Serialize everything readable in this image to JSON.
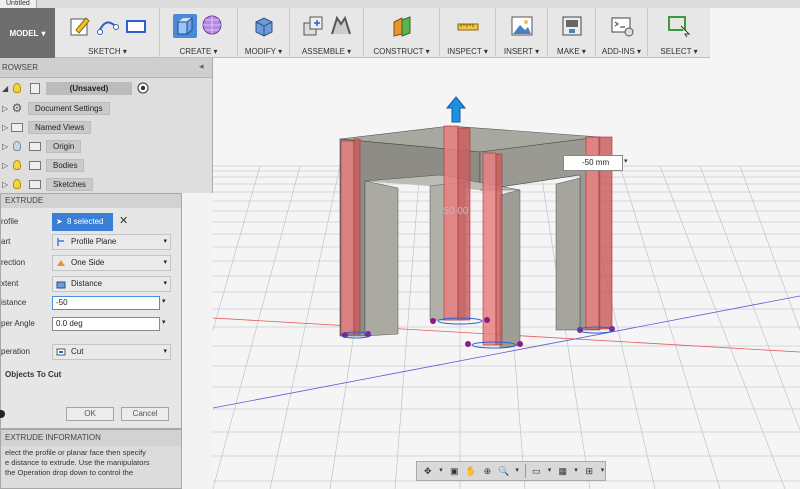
{
  "window": {
    "title_tab": "Untitled"
  },
  "toolbar": {
    "workspace": "MODEL",
    "groups": [
      {
        "label": "SKETCH ▾"
      },
      {
        "label": "CREATE ▾"
      },
      {
        "label": "MODIFY ▾"
      },
      {
        "label": "ASSEMBLE ▾"
      },
      {
        "label": "CONSTRUCT ▾"
      },
      {
        "label": "INSPECT ▾"
      },
      {
        "label": "INSERT ▾"
      },
      {
        "label": "MAKE ▾"
      },
      {
        "label": "ADD-INS ▾"
      },
      {
        "label": "SELECT ▾"
      }
    ]
  },
  "browser": {
    "title": "ROWSER",
    "items": [
      {
        "label": "(Unsaved)"
      },
      {
        "label": "Document Settings"
      },
      {
        "label": "Named Views"
      },
      {
        "label": "Origin"
      },
      {
        "label": "Bodies"
      },
      {
        "label": "Sketches"
      }
    ]
  },
  "extrude": {
    "title": "EXTRUDE",
    "profile_label": "rofile",
    "profile_value": "8 selected",
    "start_label": "art",
    "start_value": "Profile Plane",
    "direction_label": "rection",
    "direction_value": "One Side",
    "extent_label": "xtent",
    "extent_value": "Distance",
    "distance_label": "istance",
    "distance_value": "-50",
    "taper_label": "per Angle",
    "taper_value": "0.0 deg",
    "operation_label": "peration",
    "operation_value": "Cut",
    "objects_label": "Objects To Cut",
    "ok": "OK",
    "cancel": "Cancel"
  },
  "info": {
    "title": "EXTRUDE INFORMATION",
    "lines": [
      "elect the profile or planar face then specify",
      "e distance to extrude. Use the manipulators",
      "the Operation drop down to control the"
    ]
  },
  "viewport": {
    "dimension_input": "-50 mm",
    "ghost_label": "-50.00"
  },
  "colors": {
    "accent": "#3a7fd5",
    "cut_red": "#e88080",
    "body_gray": "#8d8d86"
  }
}
